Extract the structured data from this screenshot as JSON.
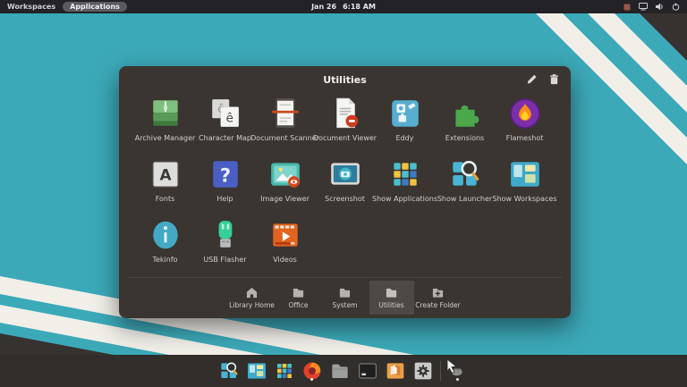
{
  "panel": {
    "left_items": [
      {
        "label": "Workspaces"
      },
      {
        "label": "Applications"
      }
    ],
    "clock": {
      "date": "Jan 26",
      "time": "6:18 AM"
    },
    "right_icons": [
      "indicator-icon",
      "display-icon",
      "volume-icon",
      "power-icon"
    ]
  },
  "dialog": {
    "title": "Utilities",
    "actions": [
      {
        "name": "edit",
        "icon": "pencil-icon"
      },
      {
        "name": "delete",
        "icon": "trash-icon"
      }
    ],
    "character_map_glyphs": [
      "ĉ",
      "ê"
    ],
    "fonts_glyph": "A",
    "help_glyph": "?",
    "apps": [
      {
        "label": "Archive Manager",
        "icon": "archive-manager-icon"
      },
      {
        "label": "Character Map",
        "icon": "character-map-icon"
      },
      {
        "label": "Document Scanner",
        "icon": "document-scanner-icon"
      },
      {
        "label": "Document Viewer",
        "icon": "document-viewer-icon"
      },
      {
        "label": "Eddy",
        "icon": "eddy-icon"
      },
      {
        "label": "Extensions",
        "icon": "extensions-icon"
      },
      {
        "label": "Flameshot",
        "icon": "flameshot-icon"
      },
      {
        "label": "Fonts",
        "icon": "fonts-icon"
      },
      {
        "label": "Help",
        "icon": "help-icon"
      },
      {
        "label": "Image Viewer",
        "icon": "image-viewer-icon"
      },
      {
        "label": "Screenshot",
        "icon": "screenshot-icon"
      },
      {
        "label": "Show Applications",
        "icon": "show-applications-icon"
      },
      {
        "label": "Show Launcher",
        "icon": "show-launcher-icon"
      },
      {
        "label": "Show Workspaces",
        "icon": "show-workspaces-icon"
      },
      {
        "label": "Tekinfo",
        "icon": "tekinfo-icon"
      },
      {
        "label": "USB Flasher",
        "icon": "usb-flasher-icon"
      },
      {
        "label": "Videos",
        "icon": "videos-icon"
      }
    ],
    "tabs": [
      {
        "label": "Library Home",
        "icon": "home-icon",
        "selected": false
      },
      {
        "label": "Office",
        "icon": "folder-icon",
        "selected": false
      },
      {
        "label": "System",
        "icon": "folder-icon",
        "selected": false
      },
      {
        "label": "Utilities",
        "icon": "folder-icon",
        "selected": true
      },
      {
        "label": "Create Folder",
        "icon": "folder-plus-icon",
        "selected": false
      }
    ]
  },
  "dock": {
    "items": [
      "show-launcher",
      "show-workspaces",
      "show-applications",
      "firefox",
      "files",
      "terminal",
      "appcenter",
      "settings",
      "trash"
    ],
    "running": [
      "firefox",
      "trash"
    ]
  },
  "colors": {
    "desktop_teal": "#3CA9B9",
    "stripe_white": "#F2EFE9",
    "dark_wedge": "#36322F",
    "panel_bg": "#232227",
    "dialog_bg": "#3A3531",
    "selected_tab_bg": "rgba(255,255,255,0.10)"
  }
}
